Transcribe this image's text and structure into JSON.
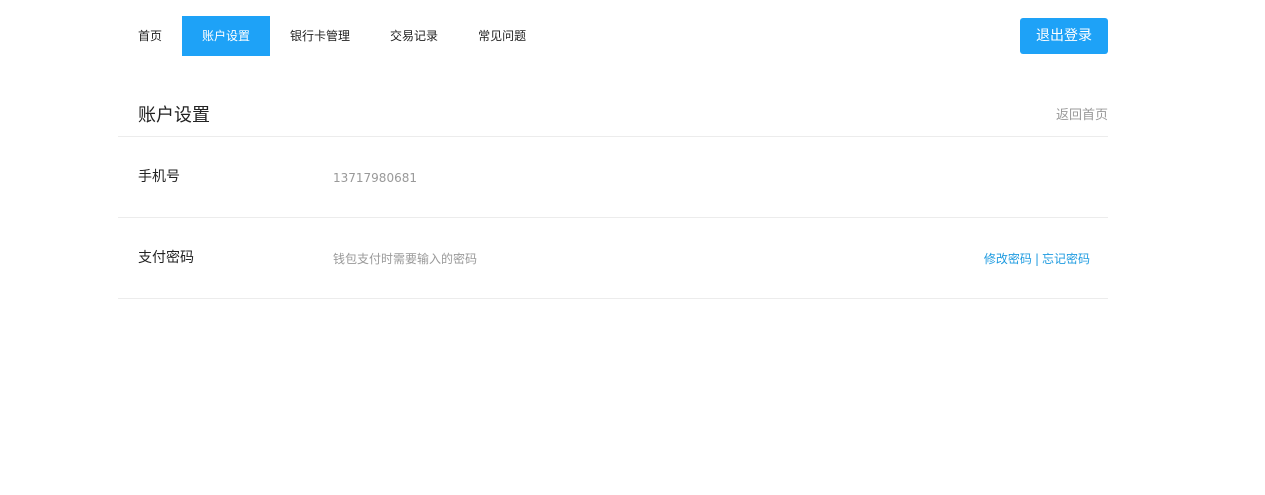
{
  "nav": {
    "items": [
      {
        "label": "首页",
        "active": false
      },
      {
        "label": "账户设置",
        "active": true
      },
      {
        "label": "银行卡管理",
        "active": false
      },
      {
        "label": "交易记录",
        "active": false
      },
      {
        "label": "常见问题",
        "active": false
      }
    ],
    "logout_label": "退出登录"
  },
  "section": {
    "title": "账户设置",
    "back_link": "返回首页"
  },
  "rows": {
    "phone": {
      "label": "手机号",
      "value": "13717980681"
    },
    "pay_password": {
      "label": "支付密码",
      "description": "钱包支付时需要输入的密码",
      "change_link": "修改密码",
      "separator": "|",
      "forgot_link": "忘记密码"
    }
  },
  "colors": {
    "accent": "#1ea2f7",
    "link": "#1e9be0",
    "muted_text": "#999999",
    "divider": "#ececec"
  }
}
